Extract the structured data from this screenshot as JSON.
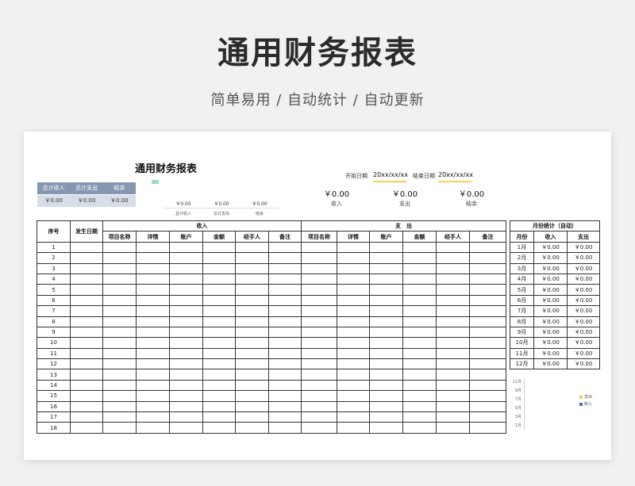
{
  "hero": {
    "title": "通用财务报表",
    "subtitle": "简单易用  /  自动统计  /  自动更新"
  },
  "sheet": {
    "title": "通用财务报表",
    "summary": {
      "headers": [
        "总计收入",
        "总计支出",
        "结余"
      ],
      "values": [
        "￥0.00",
        "￥0.00",
        "￥0.00"
      ]
    },
    "mini": {
      "values": [
        "￥0.00",
        "￥0.00",
        "￥0.00"
      ],
      "labels": [
        "总计收入",
        "总计支出",
        "结余"
      ]
    },
    "dates": {
      "start_label": "开始日期",
      "start_value": "20xx/xx/xx",
      "end_label": "结束日期",
      "end_value": "20xx/xx/xx"
    },
    "totals": {
      "values": [
        "￥0.00",
        "￥0.00",
        "￥0.00"
      ],
      "labels": [
        "收入",
        "支出",
        "结余"
      ]
    },
    "main_table": {
      "col_index": "序号",
      "col_date": "发生日期",
      "group_income": "收入",
      "group_expense": "支　出",
      "sub_headers": [
        "项目名称",
        "详情",
        "账户",
        "金额",
        "经手人",
        "备注"
      ],
      "rows": [
        "1",
        "2",
        "3",
        "4",
        "5",
        "6",
        "7",
        "8",
        "9",
        "10",
        "11",
        "12",
        "13",
        "14",
        "15",
        "16",
        "17",
        "18"
      ]
    },
    "month_table": {
      "title": "月份统计（自动）",
      "headers": [
        "月份",
        "收入",
        "支出"
      ],
      "rows": [
        {
          "m": "1月",
          "i": "￥0.00",
          "e": "￥0.00"
        },
        {
          "m": "2月",
          "i": "￥0.00",
          "e": "￥0.00"
        },
        {
          "m": "3月",
          "i": "￥0.00",
          "e": "￥0.00"
        },
        {
          "m": "4月",
          "i": "￥0.00",
          "e": "￥0.00"
        },
        {
          "m": "5月",
          "i": "￥0.00",
          "e": "￥0.00"
        },
        {
          "m": "6月",
          "i": "￥0.00",
          "e": "￥0.00"
        },
        {
          "m": "7月",
          "i": "￥0.00",
          "e": "￥0.00"
        },
        {
          "m": "8月",
          "i": "￥0.00",
          "e": "￥0.00"
        },
        {
          "m": "9月",
          "i": "￥0.00",
          "e": "￥0.00"
        },
        {
          "m": "10月",
          "i": "￥0.00",
          "e": "￥0.00"
        },
        {
          "m": "11月",
          "i": "￥0.00",
          "e": "￥0.00"
        },
        {
          "m": "12月",
          "i": "￥0.00",
          "e": "￥0.00"
        }
      ]
    },
    "chart": {
      "y_labels": [
        "11月",
        "9月",
        "7月",
        "5月",
        "3月",
        "1月"
      ],
      "legend": [
        {
          "name": "支出",
          "color": "#f0d44c"
        },
        {
          "name": "收入",
          "color": "#4a6fb5"
        }
      ]
    }
  }
}
